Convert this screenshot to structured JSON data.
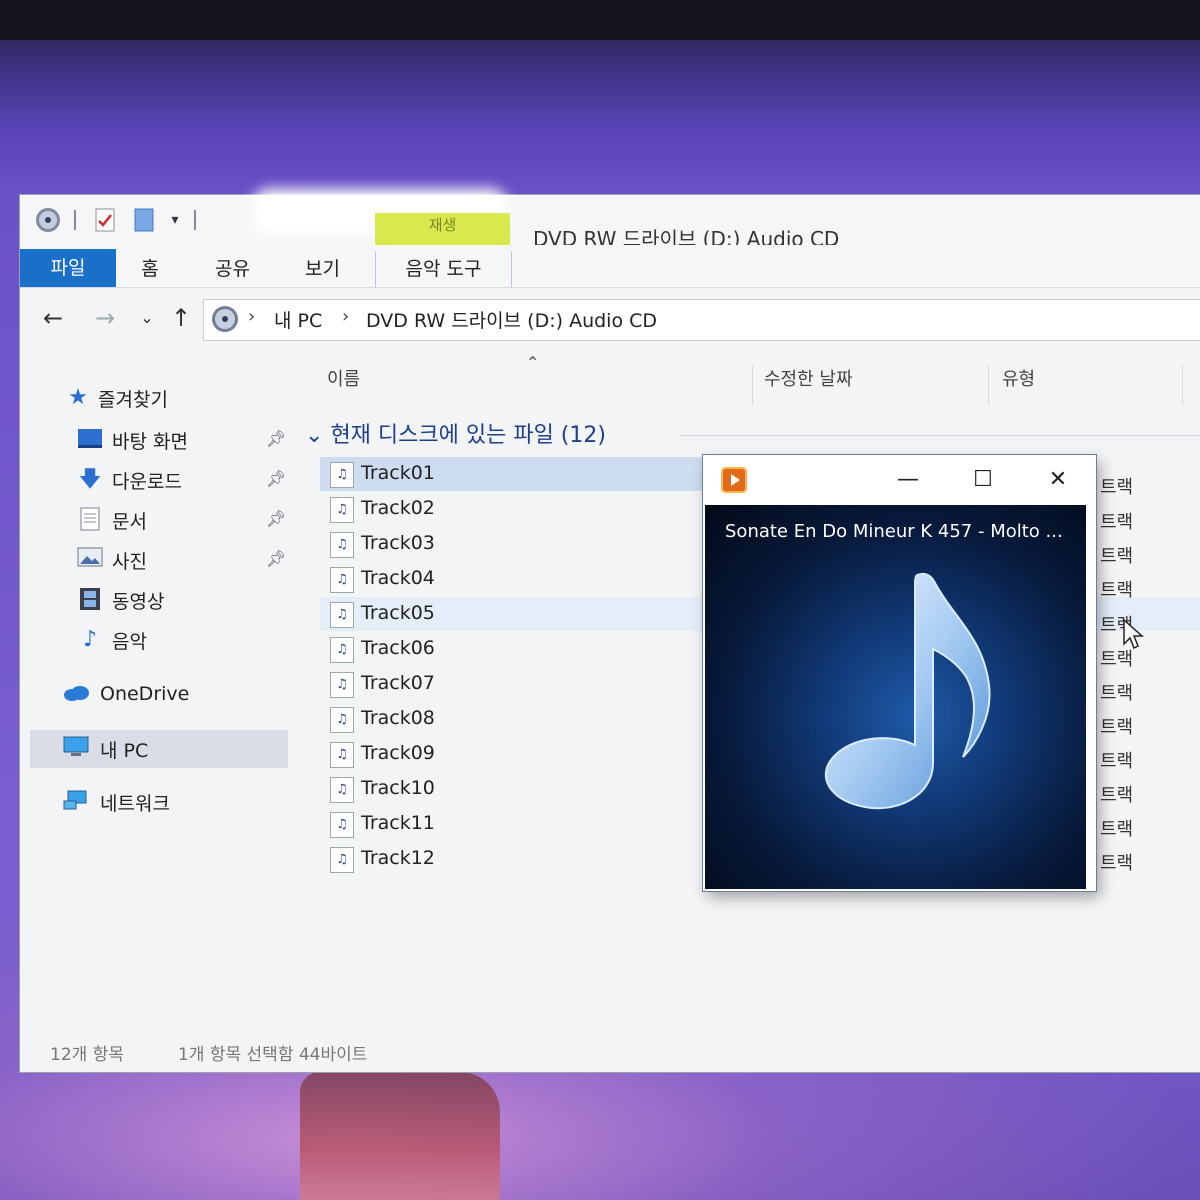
{
  "titlebar": {
    "title": "DVD RW 드라이브 (D:) Audio CD",
    "contextual_tab_header": "재생"
  },
  "ribbon": {
    "tabs": [
      "파일",
      "홈",
      "공유",
      "보기",
      "음악 도구"
    ]
  },
  "address": {
    "crumbs": [
      "내 PC",
      "DVD RW 드라이브 (D:) Audio CD"
    ]
  },
  "navpane": {
    "quick_access": "즐겨찾기",
    "items": [
      "바탕 화면",
      "다운로드",
      "문서",
      "사진",
      "동영상",
      "음악"
    ],
    "onedrive": "OneDrive",
    "this_pc": "내 PC",
    "network": "네트워크"
  },
  "columns": {
    "name": "이름",
    "modified": "수정한 날짜",
    "type": "유형"
  },
  "group": {
    "title": "현재 디스크에 있는 파일 (12)"
  },
  "files": [
    {
      "name": "Track01",
      "type": "트랙"
    },
    {
      "name": "Track02",
      "type": "트랙"
    },
    {
      "name": "Track03",
      "type": "트랙"
    },
    {
      "name": "Track04",
      "type": "트랙"
    },
    {
      "name": "Track05",
      "type": "트랙"
    },
    {
      "name": "Track06",
      "type": "트랙"
    },
    {
      "name": "Track07",
      "type": "트랙"
    },
    {
      "name": "Track08",
      "type": "트랙"
    },
    {
      "name": "Track09",
      "type": "트랙"
    },
    {
      "name": "Track10",
      "type": "트랙"
    },
    {
      "name": "Track11",
      "type": "트랙"
    },
    {
      "name": "Track12",
      "type": "트랙"
    }
  ],
  "status": {
    "count": "12개 항목",
    "selection": "1개 항목 선택함 44바이트"
  },
  "player": {
    "now_playing": "Sonate En Do Mineur K 457 - Molto ...",
    "icon": "music-note-icon"
  },
  "colors": {
    "file_tab": "#1a6fc9",
    "contextual_tab": "#d9e84e",
    "player_bg": "#0a2350"
  }
}
